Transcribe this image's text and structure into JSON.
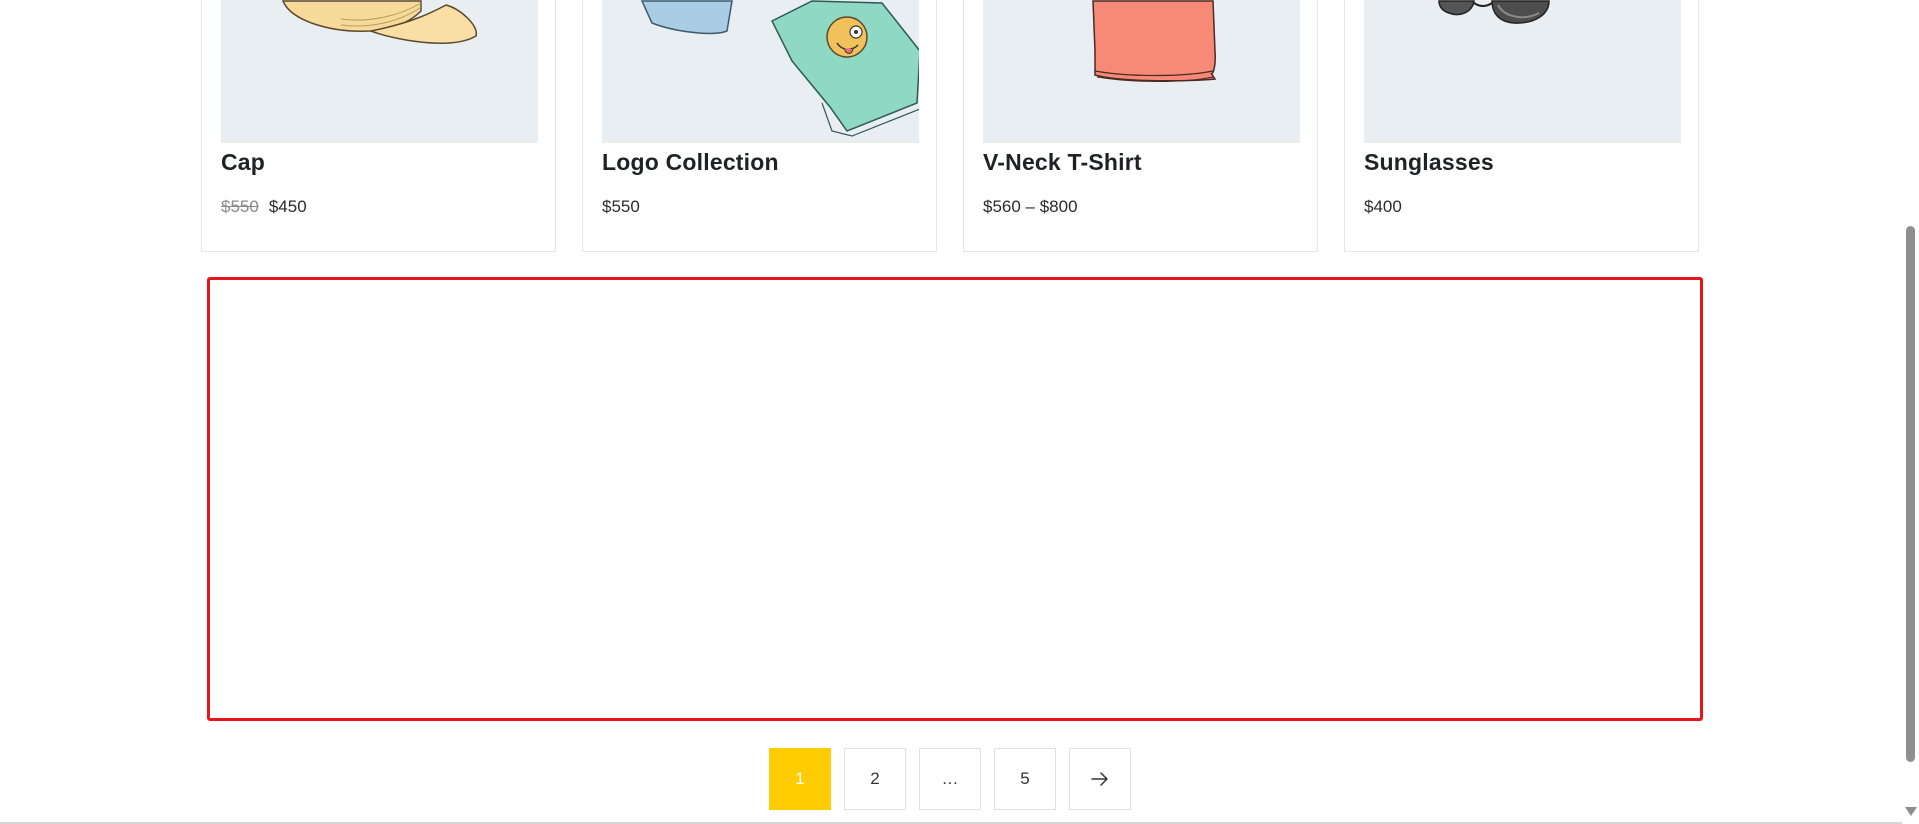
{
  "products": [
    {
      "title": "Cap",
      "price_old": "$550",
      "price": "$450",
      "image": "cap-image"
    },
    {
      "title": "Logo Collection",
      "price": "$550",
      "image": "logo-collection-image"
    },
    {
      "title": "V-Neck T-Shirt",
      "price": "$560 – $800",
      "image": "vneck-tshirt-image"
    },
    {
      "title": "Sunglasses",
      "price": "$400",
      "image": "sunglasses-image"
    }
  ],
  "pagination": {
    "pages": [
      "1",
      "2",
      "…",
      "5"
    ],
    "current": "1",
    "next_icon": "arrow-right-icon"
  },
  "colors": {
    "accent": "#ffcc00",
    "highlight": "#e8141b",
    "image_bg": "#e9eef2"
  }
}
